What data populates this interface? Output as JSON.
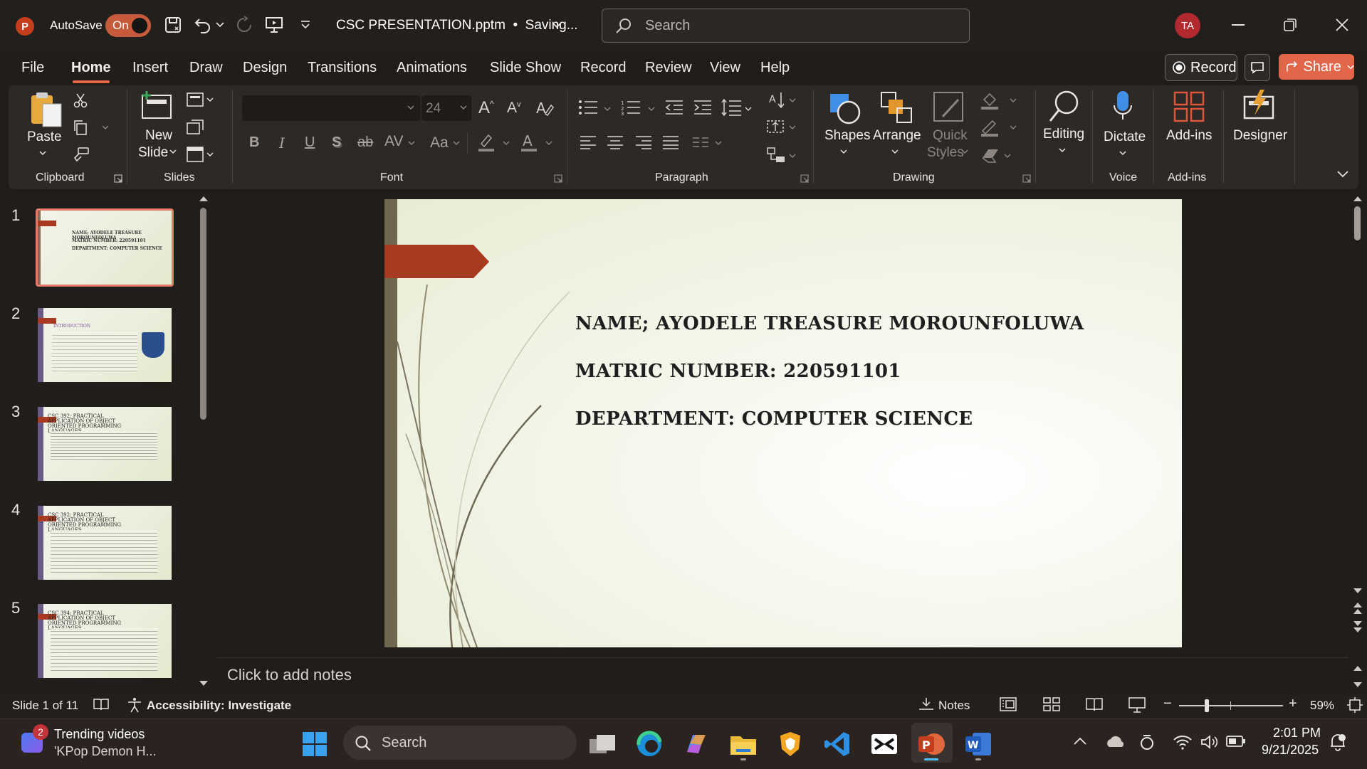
{
  "titlebar": {
    "autosave_label": "AutoSave",
    "autosave_state": "On",
    "document_title": "CSC PRESENTATION.pptm  •  Saving...",
    "search_placeholder": "Search",
    "user_initials": "TA"
  },
  "tabs": [
    "File",
    "Home",
    "Insert",
    "Draw",
    "Design",
    "Transitions",
    "Animations",
    "Slide Show",
    "Record",
    "Review",
    "View",
    "Help"
  ],
  "active_tab": "Home",
  "top_right": {
    "record_label": "Record",
    "share_label": "Share"
  },
  "ribbon": {
    "clipboard": {
      "paste_label": "Paste",
      "group_label": "Clipboard"
    },
    "slides": {
      "new_slide_line1": "New",
      "new_slide_line2": "Slide",
      "group_label": "Slides"
    },
    "font": {
      "font_size": "24",
      "group_label": "Font",
      "change_case_label": "Aa"
    },
    "paragraph": {
      "group_label": "Paragraph"
    },
    "drawing": {
      "shapes_label": "Shapes",
      "arrange_label": "Arrange",
      "quick_styles_line1": "Quick",
      "quick_styles_line2": "Styles",
      "group_label": "Drawing"
    },
    "editing": {
      "label": "Editing"
    },
    "voice": {
      "dictate_label": "Dictate",
      "group_label": "Voice"
    },
    "addins": {
      "label": "Add-ins",
      "group_label": "Add-ins"
    },
    "designer": {
      "label": "Designer"
    }
  },
  "thumbnails": [
    {
      "number": "1",
      "lines": [
        "NAME; AYODELE TREASURE MOROUNFOLUWA",
        "MATRIC NUMBER: 220591101",
        "DEPARTMENT: COMPUTER SCIENCE"
      ]
    },
    {
      "number": "2",
      "heading": "INTRODUCTION"
    },
    {
      "number": "3",
      "heading": "CSC 392: PRACTICAL APPLICATION OF OBJECT ORIENTED PROGRAMMING LANGUAGES"
    },
    {
      "number": "4",
      "heading": "CSC 392: PRACTICAL APPLICATION OF OBJECT ORIENTED PROGRAMMING LANGUAGES"
    },
    {
      "number": "5",
      "heading": "CSC 394: PRACTICAL APPLICATION OF OBJECT ORIENTED PROGRAMMING LANGUAGES"
    }
  ],
  "slide": {
    "line1": "NAME; AYODELE TREASURE MOROUNFOLUWA",
    "line2": "MATRIC NUMBER: 220591101",
    "line3": "DEPARTMENT: COMPUTER SCIENCE"
  },
  "notes_placeholder": "Click to add notes",
  "status": {
    "slide_counter": "Slide 1 of 11",
    "accessibility": "Accessibility: Investigate",
    "notes_label": "Notes",
    "zoom": "59%"
  },
  "taskbar": {
    "widget_badge": "2",
    "widget_title": "Trending videos",
    "widget_subtitle": "'KPop Demon H...",
    "search_label": "Search",
    "time": "2:01 PM",
    "date": "9/21/2025"
  },
  "colors": {
    "accent": "#e2664a",
    "slide_flag": "#a83a22",
    "powerpoint": "#c43e1c"
  }
}
